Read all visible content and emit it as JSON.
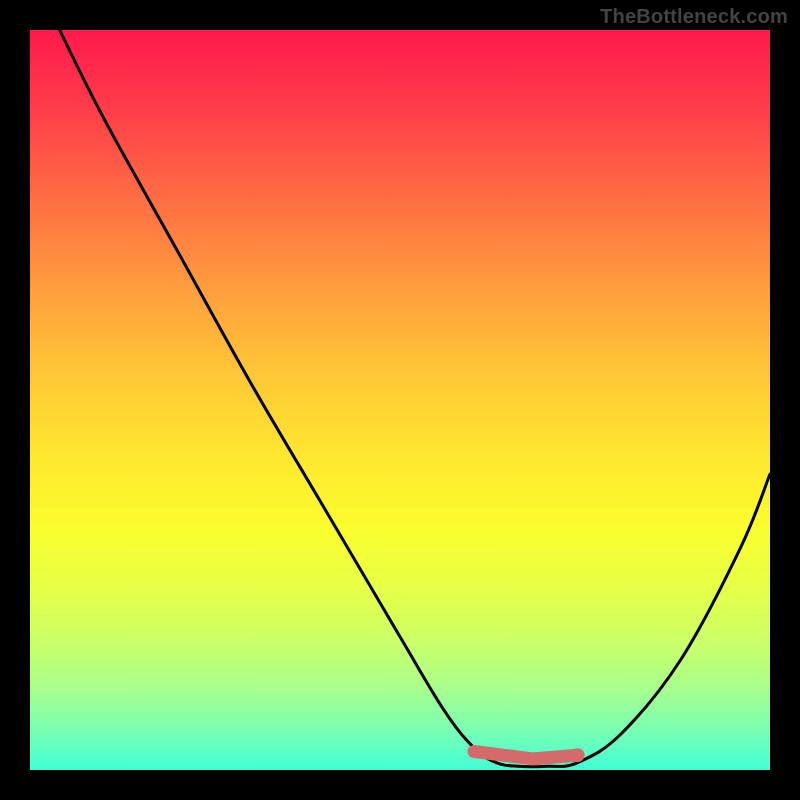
{
  "watermark": "TheBottleneck.com",
  "colors": {
    "frame": "#000000",
    "curve": "#000000",
    "marker": "#d46a6a"
  },
  "chart_data": {
    "type": "line",
    "title": "",
    "xlabel": "",
    "ylabel": "",
    "xlim": [
      0,
      100
    ],
    "ylim": [
      0,
      100
    ],
    "grid": false,
    "legend": false,
    "series": [
      {
        "name": "bottleneck-curve",
        "x": [
          4,
          10,
          20,
          30,
          40,
          50,
          56,
          60,
          63,
          66,
          70,
          74,
          80,
          88,
          96,
          100
        ],
        "values": [
          100,
          88,
          70,
          52,
          35,
          18,
          8,
          3,
          1,
          0.5,
          0.5,
          1,
          5,
          15,
          30,
          40
        ]
      }
    ],
    "markers": [
      {
        "name": "optimal-range-start",
        "x": 60,
        "y": 2.5
      },
      {
        "name": "optimal-range-mid",
        "x": 68,
        "y": 1.5
      },
      {
        "name": "optimal-range-end",
        "x": 74,
        "y": 2.0
      }
    ]
  }
}
